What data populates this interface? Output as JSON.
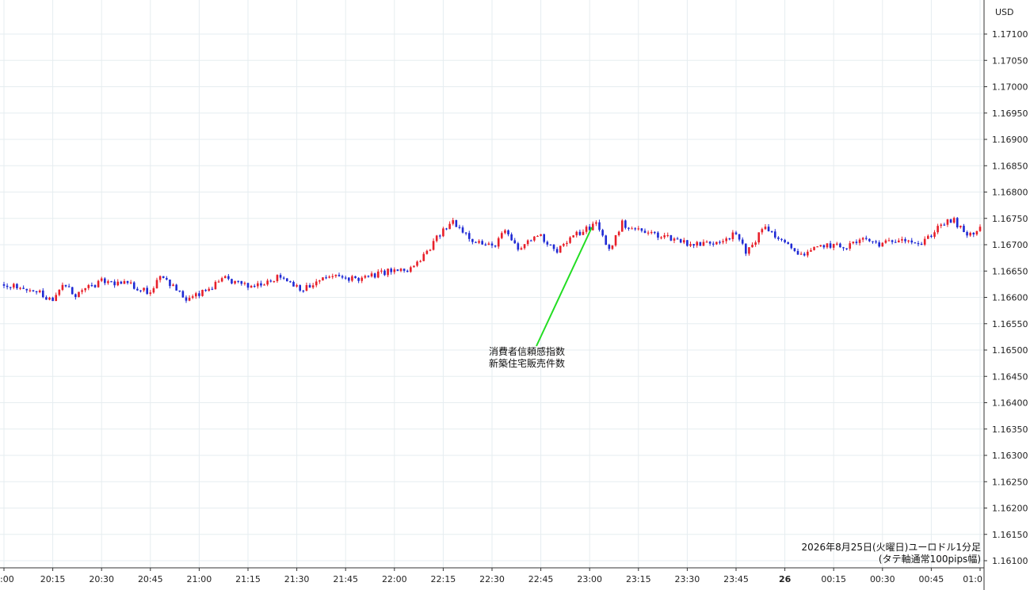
{
  "chart_data": {
    "type": "candlestick",
    "price_unit": "USD",
    "ylim": [
      1.1608,
      1.1712
    ],
    "y_ticks": [
      "1.17100",
      "1.17050",
      "1.17000",
      "1.16950",
      "1.16900",
      "1.16850",
      "1.16800",
      "1.16750",
      "1.16700",
      "1.16650",
      "1.16600",
      "1.16550",
      "1.16500",
      "1.16450",
      "1.16400",
      "1.16350",
      "1.16300",
      "1.16250",
      "1.16200",
      "1.16150",
      "1.16100"
    ],
    "x_ticks": [
      ":00",
      "20:15",
      "20:30",
      "20:45",
      "21:00",
      "21:15",
      "21:30",
      "21:45",
      "22:00",
      "22:15",
      "22:30",
      "22:45",
      "23:00",
      "23:15",
      "23:30",
      "23:45",
      "26",
      "00:15",
      "00:30",
      "00:45",
      "01:0"
    ],
    "x_tick_bold": "26",
    "series_close": [
      {
        "t": 0,
        "close": 1.16625
      },
      {
        "t": 10,
        "close": 1.16615
      },
      {
        "t": 15,
        "close": 1.1659
      },
      {
        "t": 18,
        "close": 1.16625
      },
      {
        "t": 22,
        "close": 1.16605
      },
      {
        "t": 30,
        "close": 1.1663
      },
      {
        "t": 38,
        "close": 1.16625
      },
      {
        "t": 45,
        "close": 1.1661
      },
      {
        "t": 48,
        "close": 1.16645
      },
      {
        "t": 56,
        "close": 1.16595
      },
      {
        "t": 60,
        "close": 1.16605
      },
      {
        "t": 68,
        "close": 1.16635
      },
      {
        "t": 75,
        "close": 1.1662
      },
      {
        "t": 85,
        "close": 1.1664
      },
      {
        "t": 92,
        "close": 1.16615
      },
      {
        "t": 100,
        "close": 1.1664
      },
      {
        "t": 110,
        "close": 1.16635
      },
      {
        "t": 118,
        "close": 1.1665
      },
      {
        "t": 124,
        "close": 1.1665
      },
      {
        "t": 128,
        "close": 1.1667
      },
      {
        "t": 134,
        "close": 1.1672
      },
      {
        "t": 138,
        "close": 1.16745
      },
      {
        "t": 144,
        "close": 1.1671
      },
      {
        "t": 150,
        "close": 1.16695
      },
      {
        "t": 154,
        "close": 1.16725
      },
      {
        "t": 158,
        "close": 1.1669
      },
      {
        "t": 164,
        "close": 1.1672
      },
      {
        "t": 170,
        "close": 1.1669
      },
      {
        "t": 176,
        "close": 1.1672
      },
      {
        "t": 182,
        "close": 1.1674
      },
      {
        "t": 186,
        "close": 1.1669
      },
      {
        "t": 190,
        "close": 1.1674
      },
      {
        "t": 196,
        "close": 1.16725
      },
      {
        "t": 204,
        "close": 1.16715
      },
      {
        "t": 212,
        "close": 1.167
      },
      {
        "t": 218,
        "close": 1.16705
      },
      {
        "t": 225,
        "close": 1.1672
      },
      {
        "t": 228,
        "close": 1.16685
      },
      {
        "t": 234,
        "close": 1.16735
      },
      {
        "t": 240,
        "close": 1.167
      },
      {
        "t": 246,
        "close": 1.1668
      },
      {
        "t": 252,
        "close": 1.167
      },
      {
        "t": 258,
        "close": 1.16695
      },
      {
        "t": 264,
        "close": 1.1671
      },
      {
        "t": 270,
        "close": 1.167
      },
      {
        "t": 276,
        "close": 1.16715
      },
      {
        "t": 282,
        "close": 1.167
      },
      {
        "t": 288,
        "close": 1.1674
      },
      {
        "t": 292,
        "close": 1.16745
      },
      {
        "t": 296,
        "close": 1.16715
      },
      {
        "t": 300,
        "close": 1.1673
      },
      {
        "t": 304,
        "close": 1.1674
      },
      {
        "t": 308,
        "close": 1.1672
      },
      {
        "t": 310,
        "close": 1.16725
      }
    ],
    "annotation": {
      "lines": [
        "消費者信頼感指数",
        "新築住宅販売件数"
      ],
      "time": "23:00"
    },
    "caption": [
      "2026年8月25日(火曜日)ユーロドル1分足",
      "(タテ軸通常100pips幅)"
    ],
    "up_color": "#e8202a",
    "down_color": "#1f2ad4",
    "annotation_color": "#22dd22",
    "grid": true
  }
}
